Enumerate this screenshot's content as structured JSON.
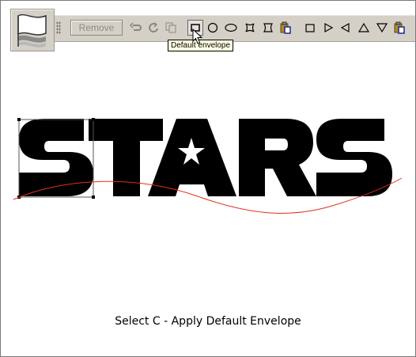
{
  "toolbar": {
    "remove_label": "Remove",
    "tooltip": "Default envelope",
    "tools": [
      {
        "icon": "undo-envelope-icon"
      },
      {
        "icon": "redo-envelope-icon"
      },
      {
        "icon": "copy-envelope-icon"
      },
      {
        "icon": "default-envelope-icon",
        "pressed": true
      },
      {
        "icon": "circle-envelope-icon"
      },
      {
        "icon": "ellipse-envelope-icon"
      },
      {
        "icon": "concave-envelope-icon"
      },
      {
        "icon": "bulge-envelope-icon"
      },
      {
        "icon": "paste-envelope-icon"
      },
      {
        "icon": "square-envelope-icon"
      },
      {
        "icon": "triangle-right-icon"
      },
      {
        "icon": "triangle-left-icon"
      },
      {
        "icon": "triangle-up-icon"
      },
      {
        "icon": "triangle-down-icon"
      },
      {
        "icon": "paste-envelope-icon-2"
      }
    ]
  },
  "canvas": {
    "artwork_text": "STARS",
    "curve_color": "#e03020"
  },
  "caption": "Select C - Apply Default Envelope"
}
